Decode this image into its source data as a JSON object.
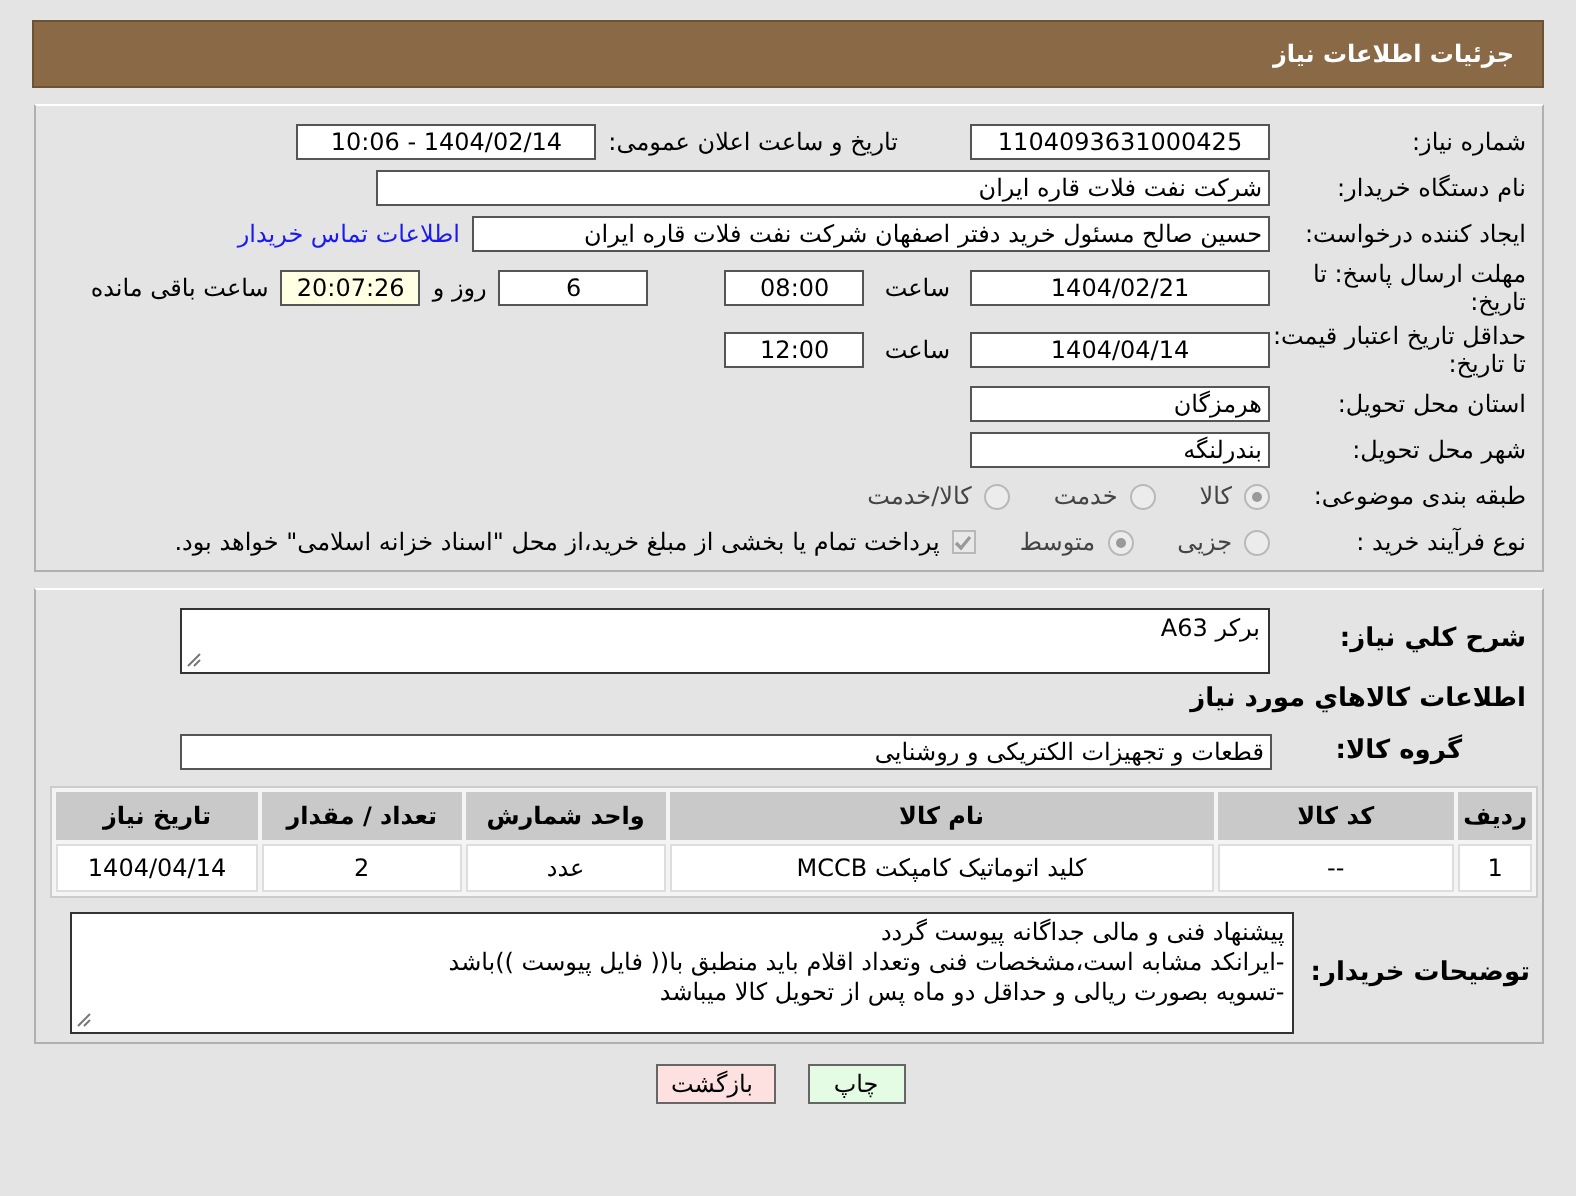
{
  "header": {
    "title": "جزئیات اطلاعات نیاز"
  },
  "need_number": {
    "label": "شماره نیاز:",
    "value": "1104093631000425"
  },
  "announce": {
    "label": "تاریخ و ساعت اعلان عمومی:",
    "value": "1404/02/14 - 10:06"
  },
  "buyer": {
    "label": "نام دستگاه خریدار:",
    "value": "شرکت نفت فلات قاره ایران"
  },
  "requester": {
    "label": "ایجاد کننده درخواست:",
    "value": "حسین  صالح مسئول خرید دفتر اصفهان شرکت نفت فلات قاره ایران",
    "link": "اطلاعات تماس خریدار"
  },
  "deadline": {
    "label": "مهلت ارسال پاسخ: تا تاریخ:",
    "date": "1404/02/21",
    "time_label": "ساعت",
    "time": "08:00",
    "days": "6",
    "days_label": "روز و",
    "remaining": "20:07:26",
    "remaining_label": "ساعت باقی مانده"
  },
  "validity": {
    "label": "حداقل تاریخ اعتبار قیمت: تا تاریخ:",
    "date": "1404/04/14",
    "time_label": "ساعت",
    "time": "12:00"
  },
  "province": {
    "label": "استان محل تحویل:",
    "value": "هرمزگان"
  },
  "city": {
    "label": "شهر محل تحویل:",
    "value": "بندرلنگه"
  },
  "category": {
    "label": "طبقه بندی موضوعی:",
    "options": [
      {
        "label": "کالا",
        "selected": true
      },
      {
        "label": "خدمت",
        "selected": false
      },
      {
        "label": "کالا/خدمت",
        "selected": false
      }
    ]
  },
  "process": {
    "label": "نوع فرآیند خرید :",
    "options": [
      {
        "label": "جزیی",
        "selected": false
      },
      {
        "label": "متوسط",
        "selected": true
      }
    ],
    "treasury": {
      "checked": true,
      "label": "پرداخت تمام یا بخشی از مبلغ خرید،از محل \"اسناد خزانه اسلامی\" خواهد بود."
    }
  },
  "summary": {
    "label": "شرح كلي نياز:",
    "value": "برکر A63"
  },
  "goods_heading": "اطلاعات كالاهاي مورد نياز",
  "goods_group": {
    "label": "گروه کالا:",
    "value": "قطعات و تجهیزات الکتریکی و روشنایی"
  },
  "table": {
    "columns": [
      "ردیف",
      "کد کالا",
      "نام کالا",
      "واحد شمارش",
      "تعداد / مقدار",
      "تاریخ نیاز"
    ],
    "rows": [
      [
        "1",
        "--",
        "کلید اتوماتیک کامپکت MCCB",
        "عدد",
        "2",
        "1404/04/14"
      ]
    ]
  },
  "notes": {
    "label": "توضیحات خریدار:",
    "lines": [
      "پیشنهاد فنی و مالی جداگانه پیوست گردد",
      "-ایرانکد مشابه است،مشخصات فنی وتعداد اقلام باید منطبق با(( فایل پیوست ))باشد",
      "-تسویه بصورت ریالی و حداقل دو ماه پس از تحویل کالا میباشد"
    ]
  },
  "buttons": [
    {
      "label": "چاپ",
      "kind": "print"
    },
    {
      "label": "بازگشت",
      "kind": "back"
    }
  ]
}
